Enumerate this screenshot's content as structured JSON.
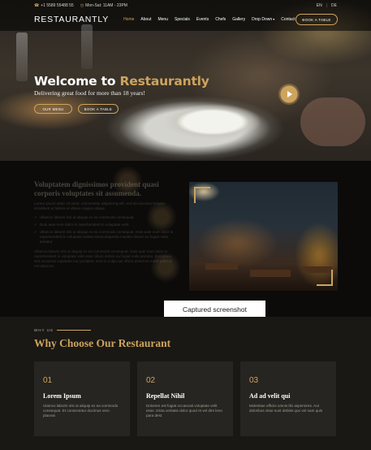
{
  "topbar": {
    "phone": "+1 5589 55488 55",
    "hours": "Mon-Sat: 11AM - 23PM",
    "lang_en": "EN",
    "lang_de": "DE"
  },
  "navbar": {
    "logo": "RESTAURANTLY",
    "items": [
      "Home",
      "About",
      "Menu",
      "Specials",
      "Events",
      "Chefs",
      "Gallery",
      "Drop Down",
      "Contact"
    ],
    "book_button": "BOOK A TABLE"
  },
  "hero": {
    "title_white": "Welcome to ",
    "title_gold": "Restaurantly",
    "subtitle": "Delivering great food for more than 18 years!",
    "btn_menu": "OUR MENU",
    "btn_table": "BOOK A TABLE"
  },
  "about": {
    "heading": "Voluptatem dignissimos provident quasi corporis voluptates sit assumenda.",
    "intro": "Lorem ipsum dolor sit amet, consectetur adipiscing elit, sed do eiusmod tempor incididunt ut labore et dolore magna aliqua.",
    "bullets": [
      "Ullamco laboris nisi ut aliquip ex ea commodo consequat.",
      "Duis aute irure dolor in reprehenderit in voluptate velit.",
      "Ullamco laboris nisi ut aliquip ex ea commodo consequat. Duis aute irure dolor in reprehenderit in voluptate trideta storacalaperda mastiro dolore eu fugiat nulla pariatur."
    ],
    "body": "Ullamco laboris nisi ut aliquip ex ea commodo consequat. Duis aute irure dolor in reprehenderit in voluptate velit esse cillum dolore eu fugiat nulla pariatur. Excepteur sint occaecat cupidatat non proident, sunt in culpa qui officia deserunt mollit anim id est laborum."
  },
  "caption": "Captured screenshot",
  "why": {
    "label": "WHY US",
    "title": "Why Choose Our Restaurant",
    "cards": [
      {
        "num": "01",
        "title": "Lorem Ipsum",
        "desc": "Ulamco laboris nisi ut aliquip ex ea commodo consequat. Et consectetur ducimus vero placeat"
      },
      {
        "num": "02",
        "title": "Repellat Nihil",
        "desc": "Dolorem est fugiat occaecati voluptate velit esse. Dicta veritatis dolor quod et vel dire leno para dest"
      },
      {
        "num": "03",
        "title": "Ad ad velit qui",
        "desc": "Molestiae officiis omnis illo asperiores. Aut doloribus vitae sunt debitis quo vel nam quis"
      }
    ]
  },
  "colors": {
    "accent": "#cda45e",
    "background": "#1a1814",
    "card": "#272521"
  }
}
